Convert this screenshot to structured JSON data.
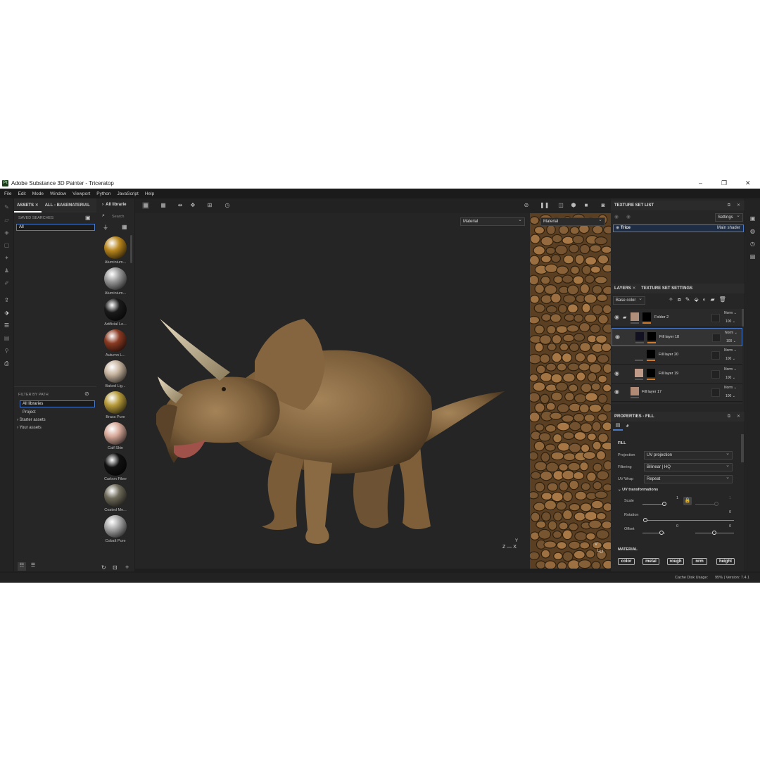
{
  "window": {
    "title": "Adobe Substance 3D Painter - Triceratop",
    "logo_text": "Pt"
  },
  "menu": [
    "File",
    "Edit",
    "Mode",
    "Window",
    "Viewport",
    "Python",
    "JavaScript",
    "Help"
  ],
  "assets_panel": {
    "tab_label": "ASSETS",
    "breadcrumb": "ALL - BASEMATERIAL",
    "saved_searches_label": "SAVED SEARCHES",
    "saved_search_value": "All",
    "filter_by_path_label": "FILTER BY PATH",
    "paths": [
      "All libraries",
      "Project",
      "Starter assets",
      "Your assets"
    ]
  },
  "library": {
    "header": "All librarie",
    "search_placeholder": "Search",
    "materials": [
      {
        "name": "Aluminium...",
        "color": "#b8861e"
      },
      {
        "name": "Aluminium...",
        "color": "#9a9a9a"
      },
      {
        "name": "Artificial Le...",
        "color": "#1a1a1a"
      },
      {
        "name": "Autumn L...",
        "color": "#8a3a22"
      },
      {
        "name": "Baked Lig...",
        "color": "#c8b5a0"
      },
      {
        "name": "Brass Pure",
        "color": "#b69a3a"
      },
      {
        "name": "Calf Skin",
        "color": "#d7a999"
      },
      {
        "name": "Carbon Fiber",
        "color": "#111111"
      },
      {
        "name": "Coated Me...",
        "color": "#6e6a5a"
      },
      {
        "name": "Cobalt Pure",
        "color": "#a8a8a8"
      }
    ]
  },
  "viewport": {
    "mode_3d": "Material",
    "mode_2d": "Material",
    "axis_3d": [
      "Z",
      "X",
      "Y"
    ],
    "axis_2d": [
      "V",
      "U"
    ]
  },
  "texture_set_list": {
    "title": "TEXTURE SET LIST",
    "settings_label": "Settings",
    "item_name": "Trice",
    "item_shader": "Main shader"
  },
  "layers": {
    "tab_layers": "LAYERS",
    "tab_settings": "TEXTURE SET SETTINGS",
    "channel": "Base color",
    "items": [
      {
        "name": "Folder 2",
        "blend": "Norm",
        "opacity": "100",
        "color": "#b0907a"
      },
      {
        "name": "Fill layer 18",
        "blend": "Norm",
        "opacity": "100",
        "color": "#111122"
      },
      {
        "name": "Fill layer 20",
        "blend": "Norm",
        "opacity": "100",
        "color": "#2a2a2a"
      },
      {
        "name": "Fill layer 19",
        "blend": "Norm",
        "opacity": "100",
        "color": "#c09a88"
      },
      {
        "name": "Fill layer 17",
        "blend": "Norm",
        "opacity": "100",
        "color": "#b08a75"
      }
    ],
    "cut_item": {
      "blend": "Norm"
    }
  },
  "properties": {
    "title": "PROPERTIES - FILL",
    "section_fill": "FILL",
    "projection_label": "Projection",
    "projection_value": "UV projection",
    "filtering_label": "Filtering",
    "filtering_value": "Bilinear | HQ",
    "uvwrap_label": "UV Wrap",
    "uvwrap_value": "Repeat",
    "uv_transform_label": "UV transformations",
    "scale_label": "Scale",
    "scale_value": "1",
    "scale_value2": "1",
    "rotation_label": "Rotation",
    "rotation_value": "0",
    "offset_label": "Offset",
    "offset_value_u": "0",
    "offset_value_v": "0",
    "material_label": "MATERIAL",
    "channels": [
      "color",
      "metal",
      "rough",
      "nrm",
      "height"
    ]
  },
  "status": {
    "cache_label": "Cache Disk Usage:",
    "cache_value": "95% | Version: 7.4.1"
  }
}
